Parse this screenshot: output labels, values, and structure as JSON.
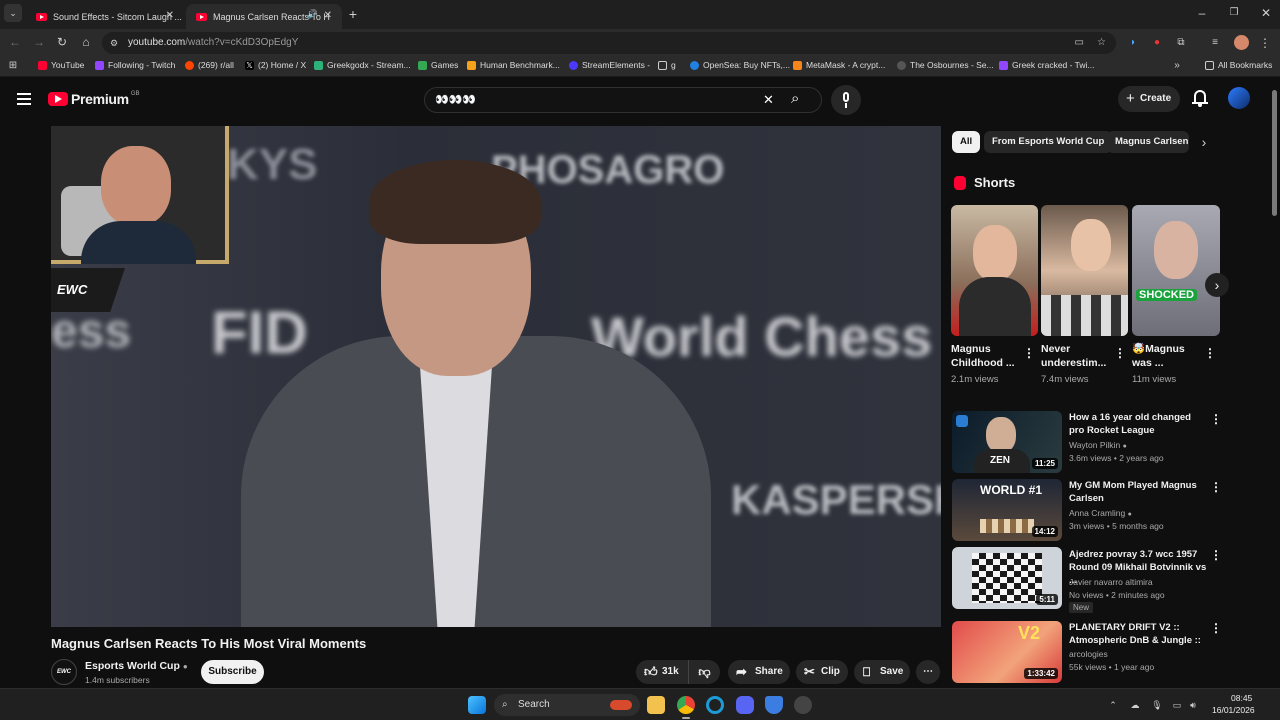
{
  "browser": {
    "tabs": [
      {
        "title": "Sound Effects - Sitcom Laugh ..."
      },
      {
        "title": "Magnus Carlsen Reacts To H"
      }
    ],
    "url_host": "youtube.com",
    "url_path": "/watch?v=cKdD3OpEdgY",
    "bookmarks": [
      "YouTube",
      "Following - Twitch",
      "(269) r/all",
      "(2) Home / X",
      "Greekgodx - Stream...",
      "Games",
      "Human Benchmark...",
      "StreamElements -",
      "g",
      "OpenSea: Buy NFTs,...",
      "MetaMask - A crypt...",
      "The Osbournes - Se...",
      "Greek cracked - Twi..."
    ],
    "all_bookmarks": "All Bookmarks"
  },
  "youtube": {
    "logo": "Premium",
    "region": "GB",
    "search_value": "👀👀👀",
    "create_label": "Create"
  },
  "video": {
    "title": "Magnus Carlsen Reacts To His Most Viral Moments",
    "channel": "Esports World Cup",
    "subscribers": "1.4m subscribers",
    "subscribe": "Subscribe",
    "likes": "31k",
    "share": "Share",
    "clip": "Clip",
    "save": "Save",
    "overlay_logo": "EWC",
    "bg_text": {
      "sponsor1": "KYS",
      "sponsor2": "PHOSAGRO",
      "fide": "FID",
      "worldchess": "World Chess",
      "kaspersky": "KASPERSK",
      "left": "ess"
    }
  },
  "chips": [
    "All",
    "From Esports World Cup",
    "Magnus Carlsen"
  ],
  "shorts": {
    "heading": "Shorts",
    "items": [
      {
        "title": "Magnus Childhood ...",
        "views": "2.1m views"
      },
      {
        "title": "Never underestim...",
        "views": "7.4m views"
      },
      {
        "title": "🤯Magnus was ...",
        "views": "11m views",
        "overlay": "SHOCKED"
      }
    ]
  },
  "recommendations": [
    {
      "title": "How a 16 year old changed pro Rocket League",
      "channel": "Wayton Pilkin",
      "meta": "3.6m views • 2 years ago",
      "duration": "11:25",
      "thumb_text": "ZEN"
    },
    {
      "title": "My GM Mom Played Magnus Carlsen",
      "channel": "Anna Cramling",
      "meta": "3m views • 5 months ago",
      "duration": "14:12",
      "thumb_text": "WORLD #1"
    },
    {
      "title": "Ajedrez povray 3.7 wcc 1957 Round 09 Mikhail Botvinnik vs ...",
      "channel": "Javier navarro altimira",
      "meta": "No views • 2 minutes ago",
      "badge": "New",
      "duration": "5:11"
    },
    {
      "title": "PLANETARY DRIFT V2 :: Atmospheric DnB & Jungle ::",
      "channel": "arcologies",
      "meta": "55k views • 1 year ago",
      "duration": "1:33:42",
      "thumb_text": "V2"
    }
  ],
  "taskbar": {
    "search": "Search",
    "time": "08:45",
    "date": "16/01/2026"
  }
}
